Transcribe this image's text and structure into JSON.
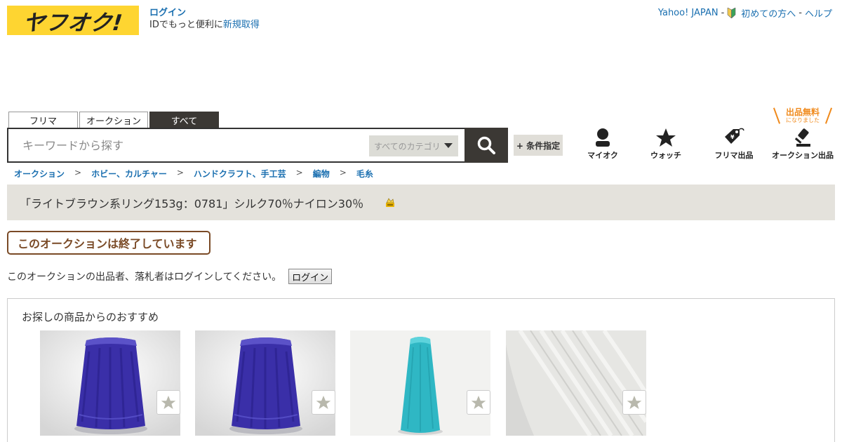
{
  "header": {
    "logo_text": "ヤフオク!",
    "login_link": "ログイン",
    "login_note_prefix": "IDでもっと便利に",
    "register_link": "新規取得",
    "links": {
      "yahoo_japan": "Yahoo! JAPAN",
      "sep1": "-",
      "beginners": "初めての方へ",
      "sep2": "-",
      "help": "ヘルプ"
    }
  },
  "search": {
    "tabs": [
      "フリマ",
      "オークション",
      "すべて"
    ],
    "active_tab": "すべて",
    "placeholder": "キーワードから探す",
    "category": "すべてのカテゴリ",
    "conditions_label": "+ 条件指定"
  },
  "nav": {
    "myauc": "マイオク",
    "watch": "ウォッチ",
    "flea_listing": "フリマ出品",
    "auction_listing": "オークション出品",
    "free_badge_main": "出品無料",
    "free_badge_sub": "になりました"
  },
  "breadcrumb": [
    "オークション",
    "ホビー、カルチャー",
    "ハンドクラフト、手工芸",
    "編物",
    "毛糸"
  ],
  "breadcrumb_sep": ">",
  "item": {
    "title": "「ライトブラウン系リング153g：0781」シルク70％ナイロン30％",
    "status": "このオークションは終了しています",
    "login_message": "このオークションの出品者、落札者はログインしてください。",
    "login_button": "ログイン"
  },
  "recommend": {
    "title": "お探しの商品からのおすすめ",
    "items": [
      {
        "image": "purple-yarn-cone",
        "color": "#3a2fa8"
      },
      {
        "image": "purple-yarn-cone",
        "color": "#3a2fa8"
      },
      {
        "image": "turquoise-yarn-cone",
        "color": "#2fb7c4"
      },
      {
        "image": "white-yarn-cone",
        "color": "#e6e6e3"
      }
    ]
  },
  "colors": {
    "logo_bg": "#fed531",
    "link": "#1a6fb0",
    "dark": "#3b3834",
    "ended": "#7a4a26",
    "free_badge": "#f08a1c"
  }
}
